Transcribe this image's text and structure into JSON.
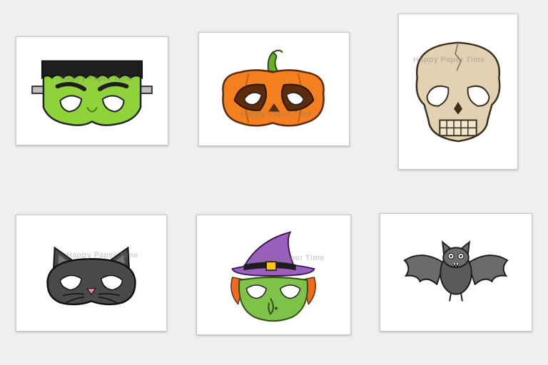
{
  "watermark": "Happy Paper Time",
  "cards": [
    {
      "mask": "frankenstein-mask"
    },
    {
      "mask": "pumpkin-mask"
    },
    {
      "mask": "skull-mask"
    },
    {
      "mask": "cat-mask"
    },
    {
      "mask": "witch-mask"
    },
    {
      "mask": "bat-mask"
    }
  ],
  "colors": {
    "background": "#efefef",
    "frankenstein_skin": "#8fd23a",
    "pumpkin": "#f37f1f",
    "skull": "#e2d2b3",
    "cat": "#4a4a4a",
    "witch_hat": "#9b5fc0",
    "witch_skin": "#7ec24a",
    "witch_hair": "#ee6a1f",
    "bat": "#6b6b6b"
  }
}
